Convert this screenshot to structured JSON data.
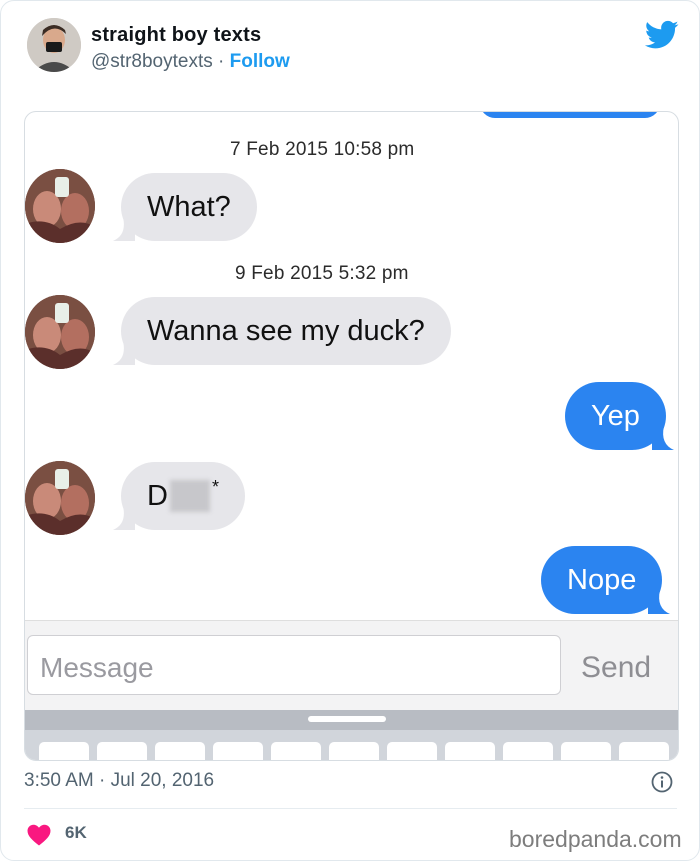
{
  "tweet": {
    "display_name": "straight boy texts",
    "handle": "@str8boytexts",
    "separator": "·",
    "follow_label": "Follow",
    "timestamp": "3:50 AM · Jul 20, 2016",
    "likes": "6K",
    "brand_color": "#1d9bf0",
    "like_color": "#f91880"
  },
  "conversation": {
    "stamps": [
      "7 Feb 2015 10:58 pm",
      "9 Feb 2015 5:32 pm"
    ],
    "messages": [
      {
        "direction": "incoming",
        "text": "What?"
      },
      {
        "direction": "incoming",
        "text": "Wanna see my duck?"
      },
      {
        "direction": "outgoing",
        "text": "Yep"
      },
      {
        "direction": "incoming",
        "text_start": "D",
        "text_end": "*",
        "redacted": true
      },
      {
        "direction": "outgoing",
        "text": "Nope"
      }
    ],
    "composer": {
      "placeholder": "Message",
      "send_label": "Send"
    },
    "outgoing_color": "#2b84f0",
    "incoming_color": "#e6e6ea"
  },
  "icons": {
    "platform": "twitter-bird-icon",
    "info": "info-icon",
    "like": "heart-icon"
  },
  "watermark": "boredpanda.com"
}
